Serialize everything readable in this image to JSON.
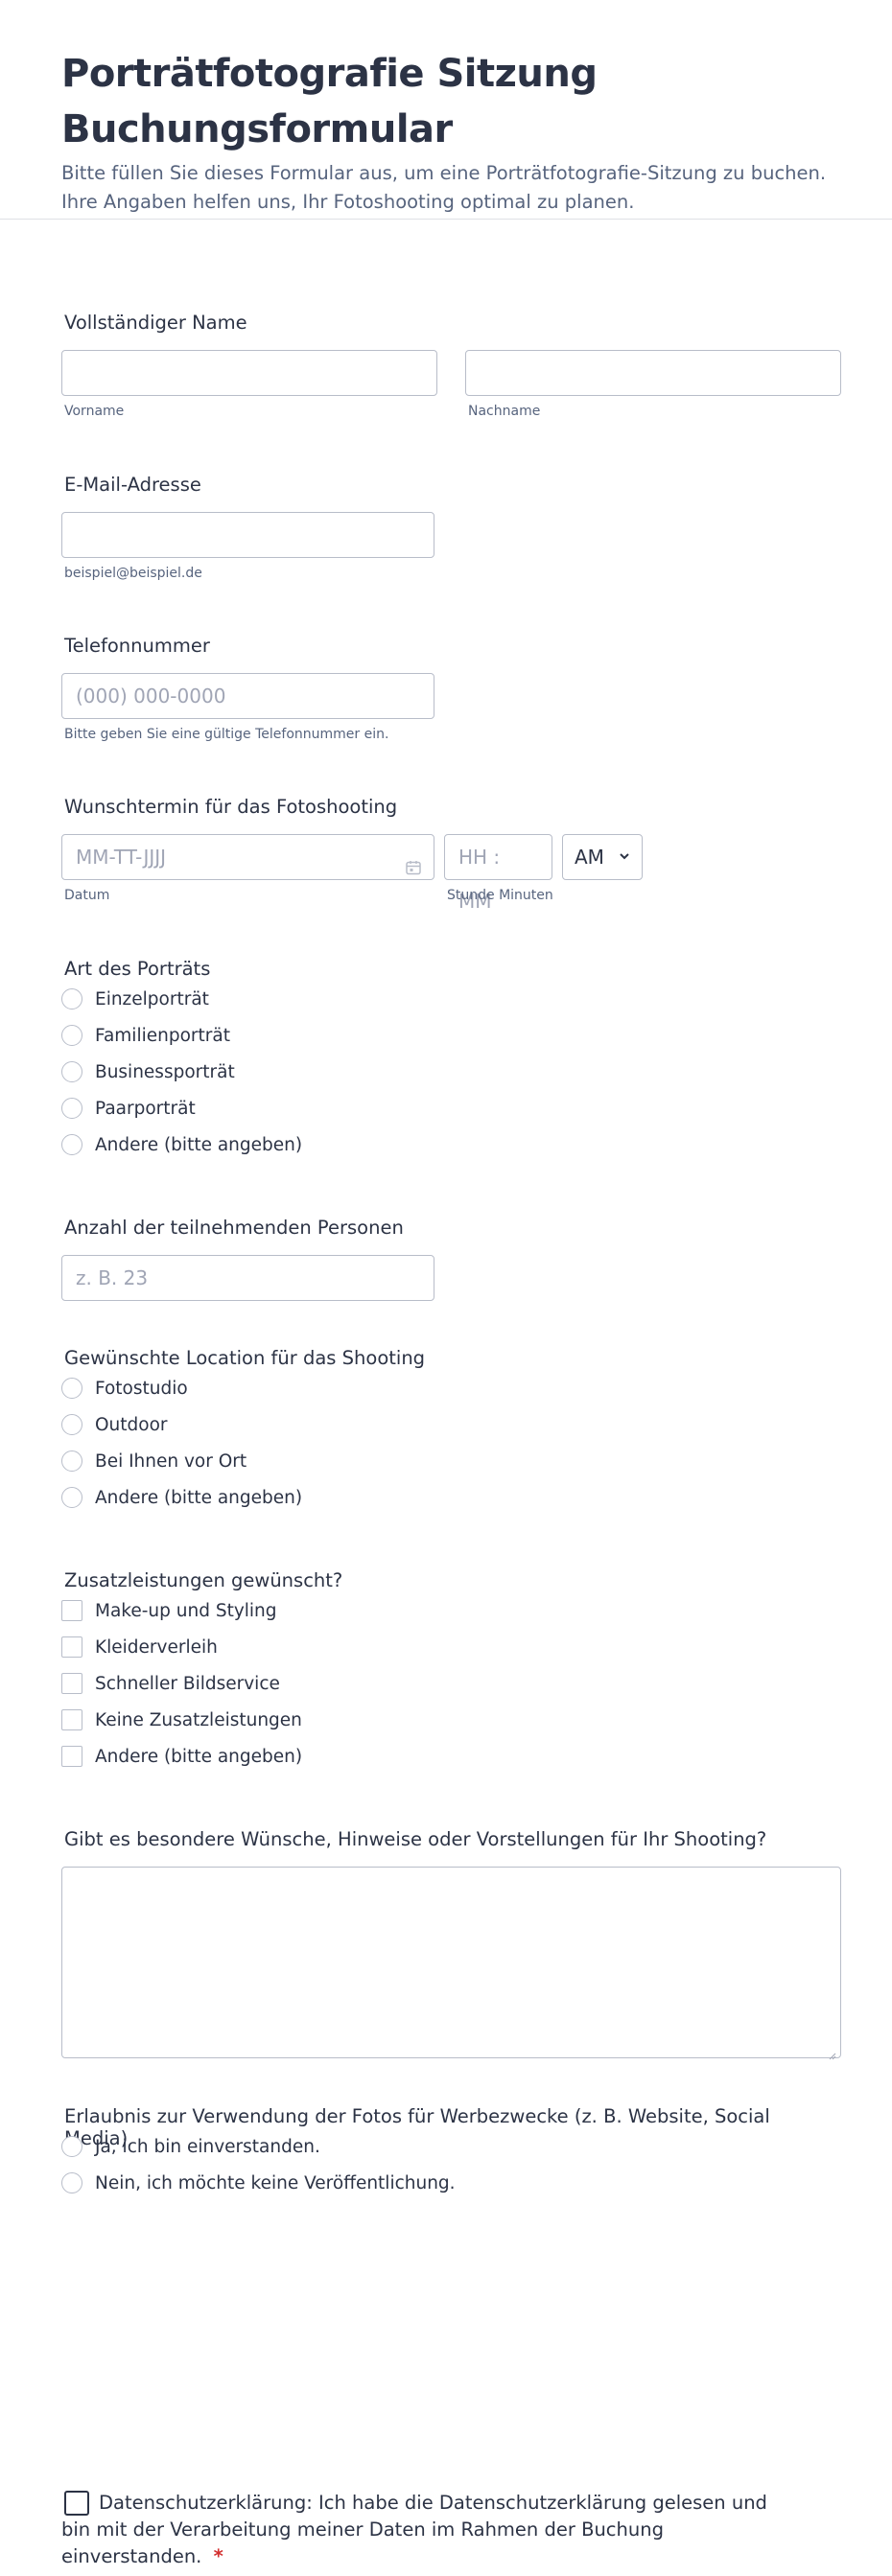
{
  "header": {
    "title": "Porträtfotografie Sitzung Buchungsformular",
    "subtitle": "Bitte füllen Sie dieses Formular aus, um eine Porträtfotografie-Sitzung zu buchen. Ihre Angaben helfen uns, Ihr Fotoshooting optimal zu planen."
  },
  "name": {
    "label": "Vollständiger Name",
    "first_sub": "Vorname",
    "last_sub": "Nachname"
  },
  "email": {
    "label": "E-Mail-Adresse",
    "sub": "beispiel@beispiel.de"
  },
  "phone": {
    "label": "Telefonnummer",
    "placeholder": "(000) 000-0000",
    "sub": "Bitte geben Sie eine gültige Telefonnummer ein."
  },
  "date": {
    "label": "Wunschtermin für das Fotoshooting",
    "date_placeholder": "MM-TT-JJJJ",
    "time_placeholder": "HH : MM",
    "ampm": "AM",
    "date_sub": "Datum",
    "time_sub": "Stunde Minuten"
  },
  "portrait_type": {
    "label": "Art des Porträts",
    "options": [
      "Einzelporträt",
      "Familienporträt",
      "Businessporträt",
      "Paarporträt",
      "Andere (bitte angeben)"
    ]
  },
  "persons": {
    "label": "Anzahl der teilnehmenden Personen",
    "placeholder": "z. B. 23"
  },
  "location": {
    "label": "Gewünschte Location für das Shooting",
    "options": [
      "Fotostudio",
      "Outdoor",
      "Bei Ihnen vor Ort",
      "Andere (bitte angeben)"
    ]
  },
  "extras": {
    "label": "Zusatzleistungen gewünscht?",
    "options": [
      "Make-up und Styling",
      "Kleiderverleih",
      "Schneller Bildservice",
      "Keine Zusatzleistungen",
      "Andere (bitte angeben)"
    ]
  },
  "wishes": {
    "label": "Gibt es besondere Wünsche, Hinweise oder Vorstellungen für Ihr Shooting?"
  },
  "permission": {
    "label": "Erlaubnis zur Verwendung der Fotos für Werbezwecke (z. B. Website, Social Media)",
    "options": [
      "Ja, ich bin einverstanden.",
      "Nein, ich möchte keine Veröffentlichung."
    ]
  },
  "privacy": {
    "line1": "Datenschutzerklärung: Ich habe die Datenschutzerklärung gelesen und",
    "line2": "bin mit der Verarbeitung meiner Daten im Rahmen der Buchung",
    "line3": "einverstanden.",
    "required_mark": "*"
  }
}
